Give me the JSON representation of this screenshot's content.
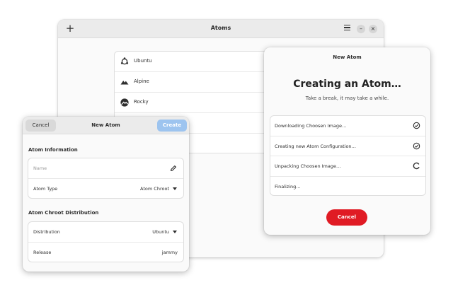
{
  "main_window": {
    "title": "Atoms",
    "add_icon": "plus-icon",
    "menu_icon": "hamburger-menu-icon",
    "minimize_label": "–",
    "close_label": "×",
    "atoms": [
      {
        "name": "Ubuntu",
        "icon": "ubuntu-logo-icon"
      },
      {
        "name": "Alpine",
        "icon": "alpine-logo-icon"
      },
      {
        "name": "Rocky",
        "icon": "rocky-logo-icon"
      }
    ]
  },
  "progress_dialog": {
    "title": "New Atom",
    "heading": "Creating an Atom…",
    "subtitle": "Take a break, it may take a while.",
    "steps": [
      {
        "label": "Downloading Choosen Image…",
        "status": "done",
        "icon": "check-circle-icon"
      },
      {
        "label": "Creating new Atom Configuration…",
        "status": "done",
        "icon": "check-circle-icon"
      },
      {
        "label": "Unpacking Choosen Image…",
        "status": "in-progress",
        "icon": "spinner-icon"
      },
      {
        "label": "Finalizing…",
        "status": "pending",
        "icon": ""
      }
    ],
    "cancel_label": "Cancel",
    "accent_color": "#e01b24"
  },
  "create_dialog": {
    "cancel_label": "Cancel",
    "title": "New Atom",
    "create_label": "Create",
    "create_color": "#9dc4ef",
    "section_info": "Atom Information",
    "name_placeholder": "Name",
    "atom_type_label": "Atom Type",
    "atom_type_value": "Atom Chroot",
    "section_distribution": "Atom Chroot Distribution",
    "distribution_label": "Distribution",
    "distribution_value": "Ubuntu",
    "release_label": "Release",
    "release_value": "jammy"
  }
}
